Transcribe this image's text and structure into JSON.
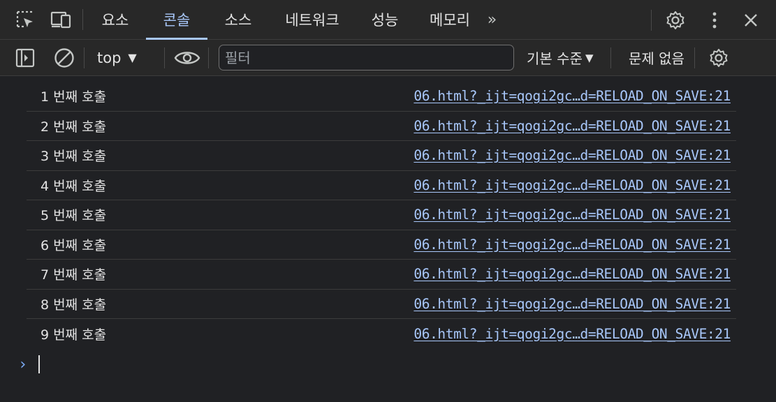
{
  "tabs": [
    {
      "label": "요소",
      "active": false
    },
    {
      "label": "콘솔",
      "active": true
    },
    {
      "label": "소스",
      "active": false
    },
    {
      "label": "네트워크",
      "active": false
    },
    {
      "label": "성능",
      "active": false
    },
    {
      "label": "메모리",
      "active": false
    }
  ],
  "more_tabs_label": "»",
  "toolbar": {
    "context": "top",
    "filter_placeholder": "필터",
    "log_levels": "기본 수준",
    "issues": "문제 없음"
  },
  "messages": [
    {
      "text": "1 번째 호출",
      "source": "06.html?_ijt=qogi2gc…d=RELOAD_ON_SAVE:21"
    },
    {
      "text": "2 번째 호출",
      "source": "06.html?_ijt=qogi2gc…d=RELOAD_ON_SAVE:21"
    },
    {
      "text": "3 번째 호출",
      "source": "06.html?_ijt=qogi2gc…d=RELOAD_ON_SAVE:21"
    },
    {
      "text": "4 번째 호출",
      "source": "06.html?_ijt=qogi2gc…d=RELOAD_ON_SAVE:21"
    },
    {
      "text": "5 번째 호출",
      "source": "06.html?_ijt=qogi2gc…d=RELOAD_ON_SAVE:21"
    },
    {
      "text": "6 번째 호출",
      "source": "06.html?_ijt=qogi2gc…d=RELOAD_ON_SAVE:21"
    },
    {
      "text": "7 번째 호출",
      "source": "06.html?_ijt=qogi2gc…d=RELOAD_ON_SAVE:21"
    },
    {
      "text": "8 번째 호출",
      "source": "06.html?_ijt=qogi2gc…d=RELOAD_ON_SAVE:21"
    },
    {
      "text": "9 번째 호출",
      "source": "06.html?_ijt=qogi2gc…d=RELOAD_ON_SAVE:21"
    }
  ],
  "prompt_symbol": "›",
  "colors": {
    "background": "#202124",
    "toolbar": "#282828",
    "accent": "#a8c7fa",
    "link": "#a8c7fa"
  }
}
